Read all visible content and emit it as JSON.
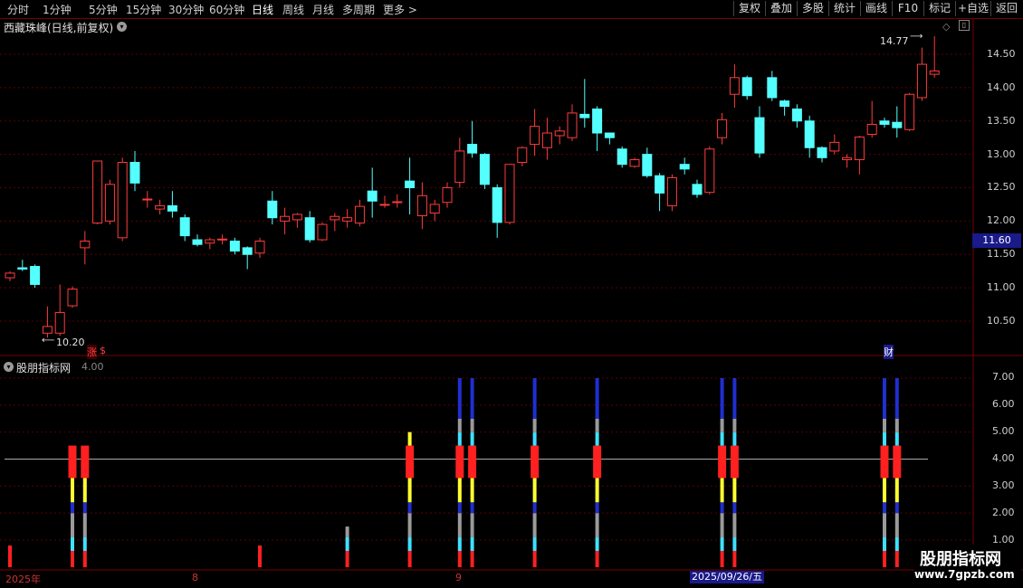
{
  "toolbar": {
    "periods": [
      "分时",
      "1分钟",
      "5分钟",
      "15分钟",
      "30分钟",
      "60分钟",
      "日线",
      "周线",
      "月线",
      "多周期",
      "更多 >"
    ],
    "active_period": "日线",
    "buttons": [
      "复权",
      "叠加",
      "多股",
      "统计",
      "画线",
      "F10",
      "标记",
      "+自选",
      "返回"
    ]
  },
  "stock_title": "西藏珠峰(日线,前复权)",
  "price_axis": [
    "14.50",
    "14.00",
    "13.50",
    "13.00",
    "12.50",
    "12.00",
    "11.50",
    "11.00",
    "10.50"
  ],
  "current_price": "11.60",
  "high_annot": "14.77",
  "low_annot": "10.20",
  "markers": {
    "zhang": "涨",
    "s": "$",
    "cai": "财"
  },
  "indicator": {
    "title": "股朋指标网",
    "value": "4.00",
    "axis": [
      "7.00",
      "6.00",
      "5.00",
      "4.00",
      "3.00",
      "2.00",
      "1.00"
    ],
    "reference_level": 4.0
  },
  "date_axis": {
    "labels": [
      "2025年",
      "8",
      "9"
    ],
    "highlighted": "2025/09/26/五"
  },
  "watermark": {
    "line1": "股朋指标网",
    "line2": "www.7gpzb.com"
  },
  "chart_data": {
    "type": "candlestick",
    "y_range": [
      10.1,
      14.9
    ],
    "candles": [
      [
        11.15,
        11.22,
        11.1,
        11.25
      ],
      [
        11.3,
        11.28,
        11.25,
        11.42
      ],
      [
        11.32,
        11.05,
        11.0,
        11.35
      ],
      [
        10.32,
        10.42,
        10.25,
        10.72
      ],
      [
        10.32,
        10.63,
        10.28,
        11.05
      ],
      [
        10.73,
        10.98,
        10.7,
        11.02
      ],
      [
        11.6,
        11.7,
        11.35,
        11.85
      ],
      [
        11.97,
        12.9,
        11.95,
        12.9
      ],
      [
        12.0,
        12.55,
        11.95,
        12.62
      ],
      [
        11.75,
        12.88,
        11.7,
        12.95
      ],
      [
        12.88,
        12.57,
        12.45,
        13.05
      ],
      [
        12.32,
        12.33,
        12.2,
        12.45
      ],
      [
        12.18,
        12.23,
        12.1,
        12.32
      ],
      [
        12.23,
        12.15,
        12.05,
        12.45
      ],
      [
        12.05,
        11.78,
        11.7,
        12.1
      ],
      [
        11.72,
        11.65,
        11.62,
        11.8
      ],
      [
        11.67,
        11.72,
        11.58,
        11.75
      ],
      [
        11.72,
        11.73,
        11.65,
        11.8
      ],
      [
        11.7,
        11.55,
        11.5,
        11.75
      ],
      [
        11.6,
        11.5,
        11.28,
        11.62
      ],
      [
        11.52,
        11.7,
        11.45,
        11.75
      ],
      [
        12.3,
        12.05,
        11.95,
        12.45
      ],
      [
        12.0,
        12.07,
        11.8,
        12.2
      ],
      [
        12.02,
        12.1,
        11.9,
        12.12
      ],
      [
        12.05,
        11.72,
        11.68,
        12.15
      ],
      [
        11.72,
        11.95,
        11.7,
        11.98
      ],
      [
        12.02,
        12.07,
        11.85,
        12.12
      ],
      [
        12.0,
        12.05,
        11.9,
        12.18
      ],
      [
        11.97,
        12.22,
        11.92,
        12.32
      ],
      [
        12.45,
        12.3,
        12.05,
        12.8
      ],
      [
        12.25,
        12.25,
        12.2,
        12.38
      ],
      [
        12.29,
        12.29,
        12.2,
        12.4
      ],
      [
        12.6,
        12.5,
        12.1,
        12.95
      ],
      [
        12.08,
        12.38,
        11.88,
        12.58
      ],
      [
        12.12,
        12.25,
        12.0,
        12.32
      ],
      [
        12.28,
        12.5,
        12.2,
        12.58
      ],
      [
        12.58,
        13.05,
        12.5,
        13.25
      ],
      [
        13.15,
        13.02,
        12.95,
        13.5
      ],
      [
        13.0,
        12.55,
        12.48,
        13.02
      ],
      [
        12.5,
        11.98,
        11.75,
        12.55
      ],
      [
        11.98,
        12.85,
        11.95,
        12.85
      ],
      [
        12.88,
        13.1,
        12.82,
        13.12
      ],
      [
        13.15,
        13.42,
        12.98,
        13.68
      ],
      [
        13.1,
        13.32,
        12.92,
        13.55
      ],
      [
        13.28,
        13.35,
        13.15,
        13.42
      ],
      [
        13.25,
        13.62,
        13.2,
        13.75
      ],
      [
        13.6,
        13.55,
        13.4,
        14.13
      ],
      [
        13.68,
        13.32,
        13.05,
        13.72
      ],
      [
        13.32,
        13.25,
        13.15,
        13.32
      ],
      [
        13.08,
        12.85,
        12.8,
        13.12
      ],
      [
        12.82,
        12.92,
        12.8,
        12.95
      ],
      [
        13.0,
        12.68,
        12.65,
        13.1
      ],
      [
        12.68,
        12.42,
        12.15,
        12.72
      ],
      [
        12.23,
        12.65,
        12.15,
        12.7
      ],
      [
        12.85,
        12.78,
        12.7,
        12.95
      ],
      [
        12.55,
        12.4,
        12.35,
        12.62
      ],
      [
        12.43,
        13.08,
        12.4,
        13.12
      ],
      [
        13.25,
        13.52,
        13.15,
        13.62
      ],
      [
        13.9,
        14.15,
        13.7,
        14.35
      ],
      [
        14.15,
        13.88,
        13.82,
        14.18
      ],
      [
        13.55,
        13.02,
        12.95,
        13.72
      ],
      [
        14.15,
        13.85,
        13.8,
        14.25
      ],
      [
        13.8,
        13.72,
        13.58,
        13.82
      ],
      [
        13.68,
        13.5,
        13.4,
        13.75
      ],
      [
        13.5,
        13.1,
        12.95,
        13.58
      ],
      [
        13.1,
        12.95,
        12.88,
        13.12
      ],
      [
        13.05,
        13.18,
        13.0,
        13.3
      ],
      [
        12.92,
        12.95,
        12.8,
        13.0
      ],
      [
        12.92,
        13.26,
        12.7,
        13.28
      ],
      [
        13.3,
        13.45,
        13.25,
        13.8
      ],
      [
        13.5,
        13.45,
        13.4,
        13.55
      ],
      [
        13.48,
        13.4,
        13.25,
        13.72
      ],
      [
        13.37,
        13.9,
        13.35,
        13.92
      ],
      [
        13.85,
        14.35,
        13.8,
        14.6
      ],
      [
        14.2,
        14.25,
        14.15,
        14.77
      ]
    ],
    "indicator_columns": [
      0,
      5,
      6,
      20,
      27,
      32,
      35,
      36,
      41,
      46,
      56,
      57,
      69,
      70
    ],
    "indicator_segments": [
      {
        "x_index": 0,
        "stack": [
          [
            "red",
            0.0,
            0.8
          ]
        ]
      },
      {
        "x_index": 5,
        "stack": [
          [
            "red",
            0.0,
            0.6
          ],
          [
            "cyan",
            0.6,
            1.1
          ],
          [
            "gray",
            1.1,
            2.0
          ],
          [
            "blue",
            2.0,
            2.4
          ],
          [
            "yellow",
            2.4,
            3.3
          ],
          [
            "red",
            3.3,
            4.5
          ]
        ]
      },
      {
        "x_index": 6,
        "stack": [
          [
            "red",
            0.0,
            0.6
          ],
          [
            "cyan",
            0.6,
            1.1
          ],
          [
            "gray",
            1.1,
            2.0
          ],
          [
            "blue",
            2.0,
            2.4
          ],
          [
            "yellow",
            2.4,
            3.3
          ],
          [
            "red",
            3.3,
            4.5
          ]
        ]
      },
      {
        "x_index": 20,
        "stack": [
          [
            "red",
            0.0,
            0.8
          ]
        ]
      },
      {
        "x_index": 27,
        "stack": [
          [
            "red",
            0.0,
            0.6
          ],
          [
            "cyan",
            0.6,
            1.1
          ],
          [
            "gray",
            1.1,
            1.5
          ]
        ]
      },
      {
        "x_index": 32,
        "stack": [
          [
            "red",
            0.0,
            0.6
          ],
          [
            "cyan",
            0.6,
            1.1
          ],
          [
            "gray",
            1.1,
            2.0
          ],
          [
            "blue",
            2.0,
            2.4
          ],
          [
            "yellow",
            2.4,
            3.3
          ],
          [
            "red",
            3.3,
            4.5
          ],
          [
            "yellow",
            4.5,
            5.0
          ]
        ]
      },
      {
        "x_index": 36,
        "stack": [
          [
            "red",
            0.0,
            0.6
          ],
          [
            "cyan",
            0.6,
            1.1
          ],
          [
            "gray",
            1.1,
            2.0
          ],
          [
            "blue",
            2.0,
            2.4
          ],
          [
            "yellow",
            2.4,
            3.3
          ],
          [
            "red",
            3.3,
            4.5
          ],
          [
            "cyan",
            4.5,
            5.0
          ],
          [
            "gray",
            5.0,
            5.5
          ],
          [
            "blue",
            5.5,
            7.0
          ]
        ]
      },
      {
        "x_index": 37,
        "stack": [
          [
            "red",
            0.0,
            0.6
          ],
          [
            "cyan",
            0.6,
            1.1
          ],
          [
            "gray",
            1.1,
            2.0
          ],
          [
            "blue",
            2.0,
            2.4
          ],
          [
            "yellow",
            2.4,
            3.3
          ],
          [
            "red",
            3.3,
            4.5
          ],
          [
            "cyan",
            4.5,
            5.0
          ],
          [
            "gray",
            5.0,
            5.5
          ],
          [
            "blue",
            5.5,
            7.0
          ]
        ]
      },
      {
        "x_index": 42,
        "stack": [
          [
            "red",
            0.0,
            0.6
          ],
          [
            "cyan",
            0.6,
            1.1
          ],
          [
            "gray",
            1.1,
            2.0
          ],
          [
            "blue",
            2.0,
            2.4
          ],
          [
            "yellow",
            2.4,
            3.3
          ],
          [
            "red",
            3.3,
            4.5
          ],
          [
            "cyan",
            4.5,
            5.0
          ],
          [
            "gray",
            5.0,
            5.5
          ],
          [
            "blue",
            5.5,
            7.0
          ]
        ]
      },
      {
        "x_index": 47,
        "stack": [
          [
            "red",
            0.0,
            0.6
          ],
          [
            "cyan",
            0.6,
            1.1
          ],
          [
            "gray",
            1.1,
            2.0
          ],
          [
            "blue",
            2.0,
            2.4
          ],
          [
            "yellow",
            2.4,
            3.3
          ],
          [
            "red",
            3.3,
            4.5
          ],
          [
            "cyan",
            4.5,
            5.0
          ],
          [
            "gray",
            5.0,
            5.5
          ],
          [
            "blue",
            5.5,
            7.0
          ]
        ]
      },
      {
        "x_index": 57,
        "stack": [
          [
            "red",
            0.0,
            0.6
          ],
          [
            "cyan",
            0.6,
            1.1
          ],
          [
            "gray",
            1.1,
            2.0
          ],
          [
            "blue",
            2.0,
            2.4
          ],
          [
            "yellow",
            2.4,
            3.3
          ],
          [
            "red",
            3.3,
            4.5
          ],
          [
            "cyan",
            4.5,
            5.0
          ],
          [
            "gray",
            5.0,
            5.5
          ],
          [
            "blue",
            5.5,
            7.0
          ]
        ]
      },
      {
        "x_index": 58,
        "stack": [
          [
            "red",
            0.0,
            0.6
          ],
          [
            "cyan",
            0.6,
            1.1
          ],
          [
            "gray",
            1.1,
            2.0
          ],
          [
            "blue",
            2.0,
            2.4
          ],
          [
            "yellow",
            2.4,
            3.3
          ],
          [
            "red",
            3.3,
            4.5
          ],
          [
            "cyan",
            4.5,
            5.0
          ],
          [
            "gray",
            5.0,
            5.5
          ],
          [
            "blue",
            5.5,
            7.0
          ]
        ]
      },
      {
        "x_index": 70,
        "stack": [
          [
            "red",
            0.0,
            0.6
          ],
          [
            "cyan",
            0.6,
            1.1
          ],
          [
            "gray",
            1.1,
            2.0
          ],
          [
            "blue",
            2.0,
            2.4
          ],
          [
            "yellow",
            2.4,
            3.3
          ],
          [
            "red",
            3.3,
            4.5
          ],
          [
            "cyan",
            4.5,
            5.0
          ],
          [
            "gray",
            5.0,
            5.5
          ],
          [
            "blue",
            5.5,
            7.0
          ]
        ]
      },
      {
        "x_index": 71,
        "stack": [
          [
            "red",
            0.0,
            0.6
          ],
          [
            "cyan",
            0.6,
            1.1
          ],
          [
            "gray",
            1.1,
            2.0
          ],
          [
            "blue",
            2.0,
            2.4
          ],
          [
            "yellow",
            2.4,
            3.3
          ],
          [
            "red",
            3.3,
            4.5
          ],
          [
            "cyan",
            4.5,
            5.0
          ],
          [
            "gray",
            5.0,
            5.5
          ],
          [
            "blue",
            5.5,
            7.0
          ]
        ]
      }
    ],
    "colors": {
      "up": "#ff3b3b",
      "down": "#54ffff",
      "red": "#ff2020",
      "cyan": "#40e0ff",
      "gray": "#9a9a9a",
      "blue": "#1f2fd0",
      "yellow": "#ffff30"
    }
  }
}
